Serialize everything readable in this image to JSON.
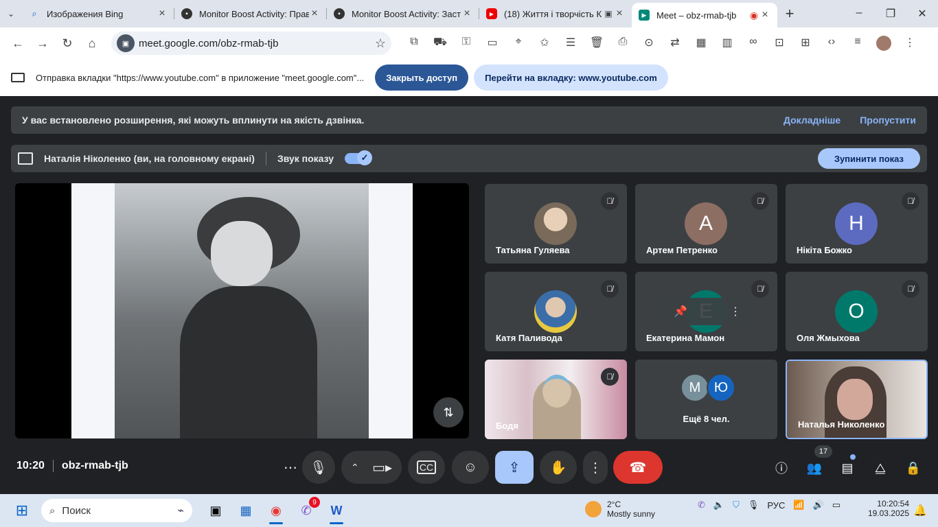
{
  "browser": {
    "tabs": [
      {
        "title": "Изображения Bing",
        "icon": "search-icon"
      },
      {
        "title": "Monitor Boost Activity: Прав",
        "icon": "monitor-boost-icon"
      },
      {
        "title": "Monitor Boost Activity: Заст",
        "icon": "monitor-boost-icon"
      },
      {
        "title": "(18) Життя і творчість К",
        "icon": "youtube-icon"
      },
      {
        "title": "Meet – obz-rmab-tjb",
        "icon": "meet-icon"
      }
    ],
    "url": "meet.google.com/obz-rmab-tjb"
  },
  "cast_bar": {
    "text": "Отправка вкладки \"https://www.youtube.com\" в приложение \"meet.google.com\"...",
    "stop_label": "Закрыть доступ",
    "goto_label": "Перейти на вкладку: www.youtube.com"
  },
  "ext_banner": {
    "text": "У вас встановлено розширення, які можуть вплинути на якість дзвінка.",
    "learn_more": "Докладніше",
    "skip": "Пропустити"
  },
  "presenting_bar": {
    "text": "Наталія Ніколенко (ви, на головному екрані)",
    "sound_label": "Звук показу",
    "sound_on": true,
    "stop_label": "Зупинити показ"
  },
  "participants": [
    {
      "name": "Татьяна Гуляева",
      "initial": "",
      "color": "",
      "muted": true
    },
    {
      "name": "Артем Петренко",
      "initial": "А",
      "color": "#8d6e63",
      "muted": true
    },
    {
      "name": "Нікіта Божко",
      "initial": "Н",
      "color": "#5c6bc0",
      "muted": true
    },
    {
      "name": "Катя Паливода",
      "initial": "",
      "color": "",
      "muted": true
    },
    {
      "name": "Екатерина Мамон",
      "initial": "Е",
      "color": "#00796b",
      "muted": true
    },
    {
      "name": "Оля Жмыхова",
      "initial": "О",
      "color": "#00796b",
      "muted": true
    },
    {
      "name": "Бодя",
      "initial": "",
      "color": "",
      "muted": true
    },
    {
      "name": "Наталья Николенко",
      "initial": "",
      "color": "",
      "muted": false
    }
  ],
  "more_tile": {
    "label": "Ещё 8 чел.",
    "initials": [
      {
        "letter": "М",
        "color": "#78909c"
      },
      {
        "letter": "Ю",
        "color": "#1565c0"
      }
    ]
  },
  "controls": {
    "time": "10:20",
    "meeting_code": "obz-rmab-tjb",
    "participant_count": "17"
  },
  "taskbar": {
    "search_placeholder": "Поиск",
    "viber_badge": "9",
    "weather_temp": "2°C",
    "weather_desc": "Mostly sunny",
    "language": "РУС",
    "clock_time": "10:20:54",
    "clock_date": "19.03.2025"
  }
}
